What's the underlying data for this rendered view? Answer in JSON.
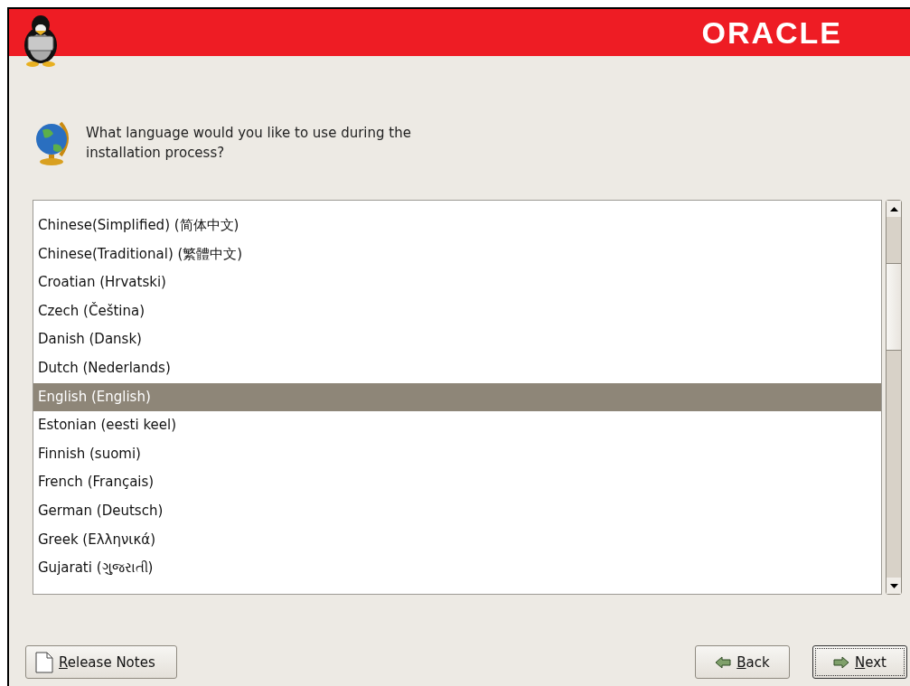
{
  "banner": {
    "logo": "ORACLE"
  },
  "question": "What language would you like to use during the installation process?",
  "languages": [
    {
      "label": "Chinese(Simplified) (简体中文)",
      "selected": false
    },
    {
      "label": "Chinese(Traditional) (繁體中文)",
      "selected": false
    },
    {
      "label": "Croatian (Hrvatski)",
      "selected": false
    },
    {
      "label": "Czech (Čeština)",
      "selected": false
    },
    {
      "label": "Danish (Dansk)",
      "selected": false
    },
    {
      "label": "Dutch (Nederlands)",
      "selected": false
    },
    {
      "label": "English (English)",
      "selected": true
    },
    {
      "label": "Estonian (eesti keel)",
      "selected": false
    },
    {
      "label": "Finnish (suomi)",
      "selected": false
    },
    {
      "label": "French (Français)",
      "selected": false
    },
    {
      "label": "German (Deutsch)",
      "selected": false
    },
    {
      "label": "Greek (Ελληνικά)",
      "selected": false
    },
    {
      "label": "Gujarati (ગુજરાતી)",
      "selected": false
    }
  ],
  "buttons": [
    {
      "kind": "notes",
      "label": "Release Notes",
      "focused": false
    },
    {
      "kind": "back",
      "label": "Back",
      "focused": false
    },
    {
      "kind": "next",
      "label": "Next",
      "focused": true
    }
  ]
}
